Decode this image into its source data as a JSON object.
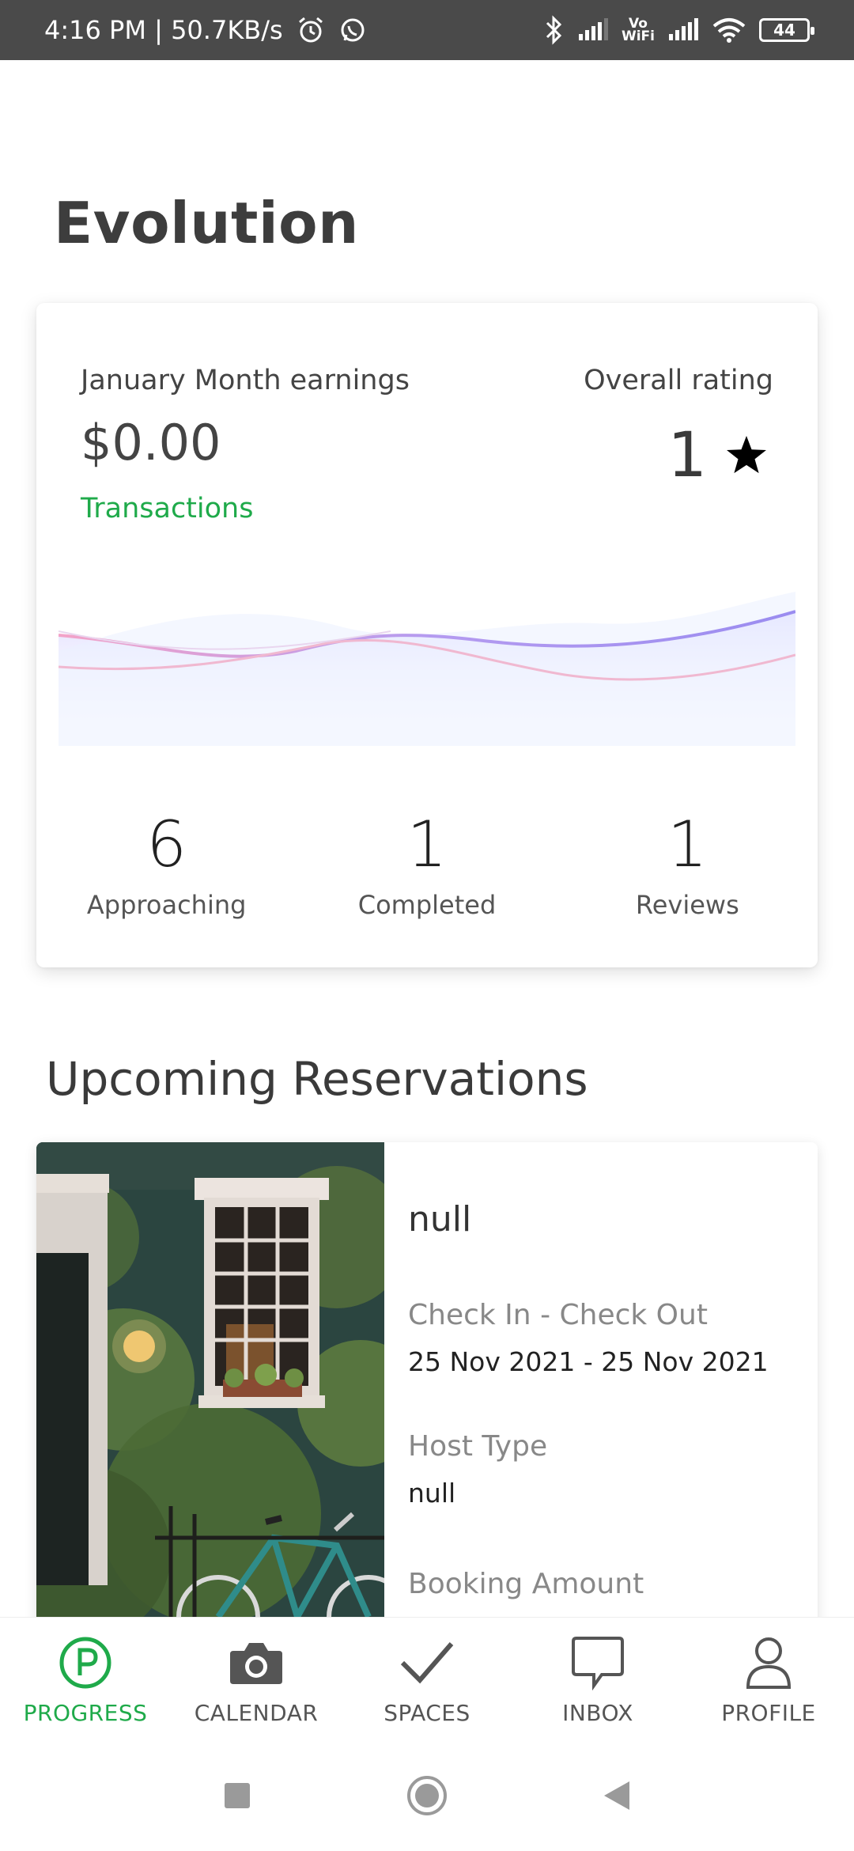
{
  "status_bar": {
    "time_speed": "4:16 PM | 50.7KB/s",
    "vowifi_top": "Vo",
    "vowifi_bottom": "WiFi",
    "battery": "44"
  },
  "page": {
    "title": "Evolution"
  },
  "earnings_card": {
    "earnings_label": "January Month earnings",
    "earnings_value": "$0.00",
    "transactions_link": "Transactions",
    "rating_label": "Overall rating",
    "rating_value": "1",
    "stats": [
      {
        "value": "6",
        "label": "Approaching"
      },
      {
        "value": "1",
        "label": "Completed"
      },
      {
        "value": "1",
        "label": "Reviews"
      }
    ]
  },
  "reservations": {
    "section_title": "Upcoming Reservations",
    "item": {
      "title": "null",
      "dates_label": "Check In - Check Out",
      "dates_value": "25 Nov 2021 - 25 Nov 2021",
      "host_type_label": "Host Type",
      "host_type_value": "null",
      "amount_label": "Booking Amount"
    }
  },
  "bottom_nav": {
    "items": [
      {
        "label": "PROGRESS",
        "icon": "progress-p-icon",
        "active": true
      },
      {
        "label": "CALENDAR",
        "icon": "camera-icon",
        "active": false
      },
      {
        "label": "SPACES",
        "icon": "checkmark-icon",
        "active": false
      },
      {
        "label": "INBOX",
        "icon": "chat-bubble-icon",
        "active": false
      },
      {
        "label": "PROFILE",
        "icon": "person-icon",
        "active": false
      }
    ]
  },
  "colors": {
    "accent_green": "#1faa4a",
    "status_bar": "#4a4a4a",
    "text_dark": "#3d3d3d"
  }
}
